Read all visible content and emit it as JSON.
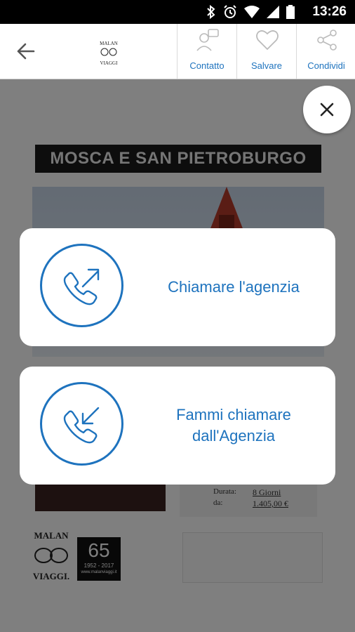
{
  "status_bar": {
    "time": "13:26",
    "icons": [
      "bluetooth-icon",
      "alarm-icon",
      "wifi-icon",
      "signal-icon",
      "battery-icon"
    ]
  },
  "app_bar": {
    "logo_text": "MALAN VIAGGI",
    "actions": [
      {
        "label": "Contatto",
        "icon": "contact-icon"
      },
      {
        "label": "Salvare",
        "icon": "heart-icon"
      },
      {
        "label": "Condividi",
        "icon": "share-icon"
      }
    ]
  },
  "background": {
    "banner_title": "MOSCA E SAN PIETROBURGO",
    "details": [
      {
        "label": "Durata:",
        "value": "8 Giorni"
      },
      {
        "label": "da:",
        "value": "1.405,00 €"
      }
    ],
    "logo_text": "MALAN VIAGGI",
    "badge": {
      "number": "65",
      "years": "1952 - 2017",
      "site": "www.malanviaggi.it"
    }
  },
  "dialog": {
    "options": [
      {
        "lines": [
          "Chiamare l'agenzia"
        ],
        "icon": "outgoing-call-icon"
      },
      {
        "lines": [
          "Fammi chiamare",
          "dall'Agenzia"
        ],
        "icon": "incoming-call-icon"
      }
    ]
  },
  "colors": {
    "accent": "#1e73be",
    "overlay": "rgba(0,0,0,0.5)",
    "status_bar": "#000000"
  }
}
